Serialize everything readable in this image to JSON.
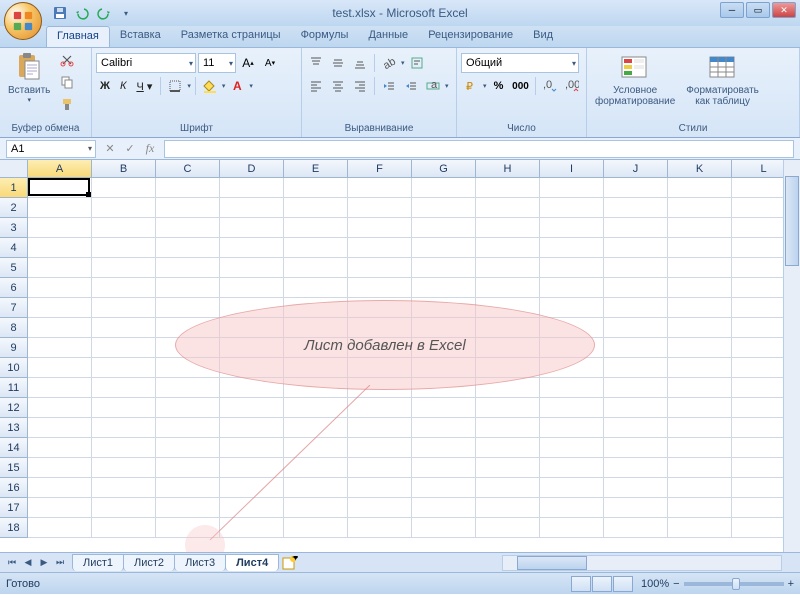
{
  "title": "test.xlsx - Microsoft Excel",
  "tabs": {
    "home": "Главная",
    "insert": "Вставка",
    "pagelayout": "Разметка страницы",
    "formulas": "Формулы",
    "data": "Данные",
    "review": "Рецензирование",
    "view": "Вид"
  },
  "groups": {
    "clipboard": "Буфер обмена",
    "font": "Шрифт",
    "alignment": "Выравнивание",
    "number": "Число",
    "styles": "Стили"
  },
  "clipboard": {
    "paste": "Вставить"
  },
  "font": {
    "name": "Calibri",
    "size": "11"
  },
  "number": {
    "format": "Общий"
  },
  "styles": {
    "cond": "Условное\nформатирование",
    "table": "Форматировать\nкак таблицу"
  },
  "namebox": "A1",
  "columns": [
    "A",
    "B",
    "C",
    "D",
    "E",
    "F",
    "G",
    "H",
    "I",
    "J",
    "K",
    "L"
  ],
  "rows": [
    "1",
    "2",
    "3",
    "4",
    "5",
    "6",
    "7",
    "8",
    "9",
    "10",
    "11",
    "12",
    "13",
    "14",
    "15",
    "16",
    "17",
    "18"
  ],
  "annotation": "Лист добавлен в Excel",
  "sheets": [
    "Лист1",
    "Лист2",
    "Лист3",
    "Лист4"
  ],
  "active_sheet": 3,
  "status": "Готово",
  "zoom": "100%"
}
